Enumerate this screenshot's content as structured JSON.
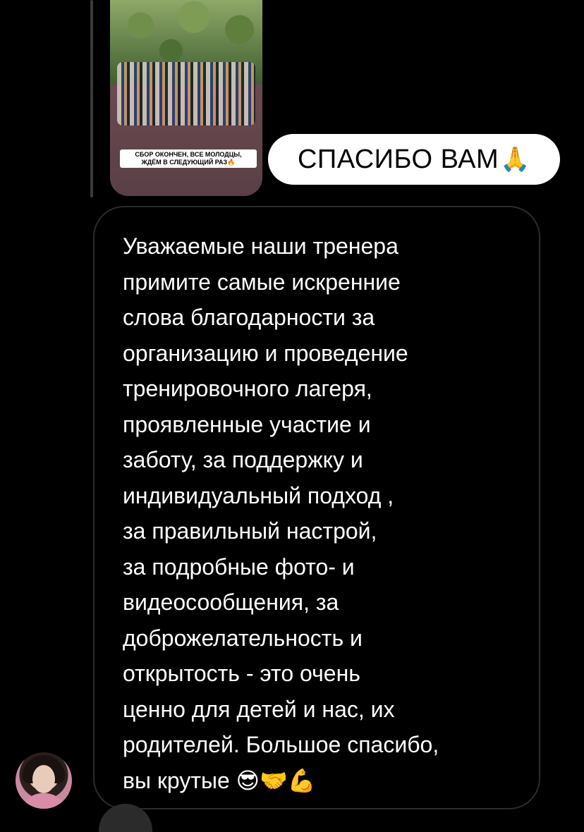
{
  "story": {
    "caption_line1": "СБОР ОКОНЧЕН, ВСЕ МОЛОДЦЫ,",
    "caption_line2": "ЖДЁМ В СЛЕДУЮЩИЙ РАЗ🔥"
  },
  "reaction": {
    "text": "СПАСИБО ВАМ",
    "emoji": "🙏"
  },
  "message": {
    "text": "Уважаемые наши тренера\nпримите самые искренние\nслова благодарности за\nорганизацию и проведение\nтренировочного лагеря,\nпроявленные участие и\nзаботу, за поддержку и\nиндивидуальный подход ,\nза правильный настрой,\nза подробные фото- и\nвидеосообщения, за\nдоброжелательность и\nоткрытость - это очень\nценно для детей и нас, их\nродителей. Большое спасибо,\nвы крутые 😎🤝💪"
  },
  "colors": {
    "background": "#000000",
    "bubble_border": "#2b2b2b",
    "reaction_bg": "#ffffff"
  }
}
